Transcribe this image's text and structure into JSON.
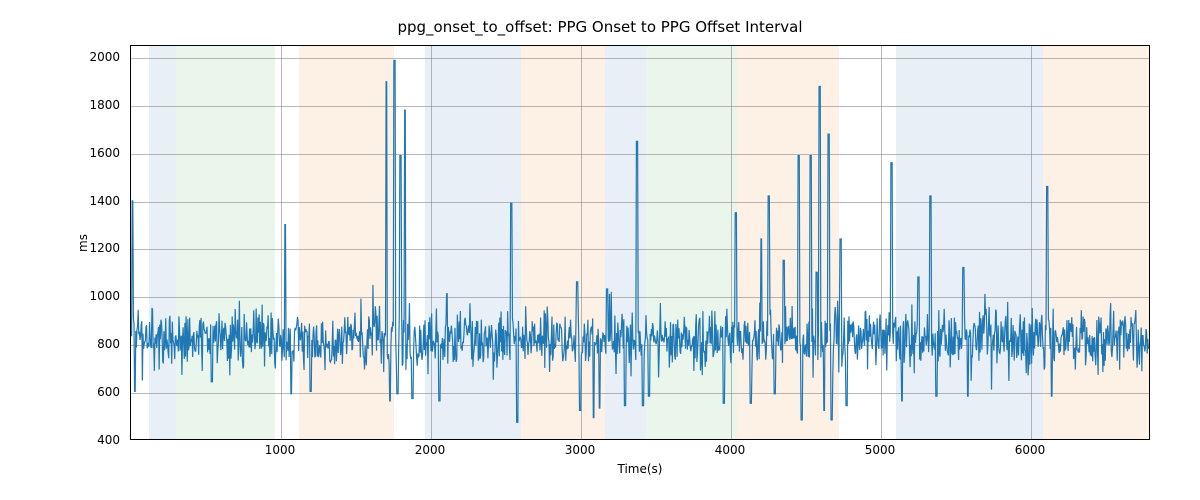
{
  "chart_data": {
    "type": "line",
    "title": "ppg_onset_to_offset: PPG Onset to PPG Offset Interval",
    "xlabel": "Time(s)",
    "ylabel": "ms",
    "xlim": [
      0,
      6800
    ],
    "ylim": [
      400,
      2050
    ],
    "xticks": [
      1000,
      2000,
      3000,
      4000,
      5000,
      6000
    ],
    "yticks": [
      400,
      600,
      800,
      1000,
      1200,
      1400,
      1600,
      1800,
      2000
    ],
    "line_color": "#1f77b4",
    "band_colors": {
      "blue": "#b9cee4",
      "green": "#bfe1c3",
      "orange": "#f9d5b0"
    },
    "bands": [
      {
        "start": 120,
        "end": 300,
        "color": "blue"
      },
      {
        "start": 300,
        "end": 960,
        "color": "green"
      },
      {
        "start": 1120,
        "end": 1750,
        "color": "orange"
      },
      {
        "start": 1960,
        "end": 2600,
        "color": "blue"
      },
      {
        "start": 2600,
        "end": 3160,
        "color": "orange"
      },
      {
        "start": 3160,
        "end": 3430,
        "color": "blue"
      },
      {
        "start": 3430,
        "end": 4040,
        "color": "green"
      },
      {
        "start": 4040,
        "end": 4720,
        "color": "orange"
      },
      {
        "start": 5100,
        "end": 6080,
        "color": "blue"
      },
      {
        "start": 6080,
        "end": 6800,
        "color": "orange"
      }
    ],
    "series": [
      {
        "name": "ppg_onset_to_offset",
        "baseline_mean": 820,
        "baseline_noise_sd": 65,
        "spikes": [
          {
            "t": 10,
            "v": 1400
          },
          {
            "t": 25,
            "v": 600
          },
          {
            "t": 540,
            "v": 640
          },
          {
            "t": 1030,
            "v": 1300
          },
          {
            "t": 1070,
            "v": 590
          },
          {
            "t": 1200,
            "v": 600
          },
          {
            "t": 1705,
            "v": 1900
          },
          {
            "t": 1730,
            "v": 560
          },
          {
            "t": 1760,
            "v": 1990
          },
          {
            "t": 1780,
            "v": 590
          },
          {
            "t": 1800,
            "v": 1590
          },
          {
            "t": 1830,
            "v": 1780
          },
          {
            "t": 1880,
            "v": 570
          },
          {
            "t": 2060,
            "v": 560
          },
          {
            "t": 2110,
            "v": 1010
          },
          {
            "t": 2540,
            "v": 1390
          },
          {
            "t": 2580,
            "v": 470
          },
          {
            "t": 2980,
            "v": 1060
          },
          {
            "t": 3000,
            "v": 520
          },
          {
            "t": 3090,
            "v": 490
          },
          {
            "t": 3130,
            "v": 530
          },
          {
            "t": 3180,
            "v": 1030
          },
          {
            "t": 3300,
            "v": 540
          },
          {
            "t": 3380,
            "v": 1650
          },
          {
            "t": 3420,
            "v": 540
          },
          {
            "t": 3460,
            "v": 580
          },
          {
            "t": 3960,
            "v": 550
          },
          {
            "t": 4040,
            "v": 1350
          },
          {
            "t": 4140,
            "v": 550
          },
          {
            "t": 4210,
            "v": 1240
          },
          {
            "t": 4260,
            "v": 1420
          },
          {
            "t": 4300,
            "v": 590
          },
          {
            "t": 4360,
            "v": 1150
          },
          {
            "t": 4460,
            "v": 1590
          },
          {
            "t": 4480,
            "v": 480
          },
          {
            "t": 4540,
            "v": 1590
          },
          {
            "t": 4580,
            "v": 1100
          },
          {
            "t": 4600,
            "v": 1880
          },
          {
            "t": 4630,
            "v": 520
          },
          {
            "t": 4660,
            "v": 1680
          },
          {
            "t": 4680,
            "v": 480
          },
          {
            "t": 4740,
            "v": 1240
          },
          {
            "t": 4780,
            "v": 540
          },
          {
            "t": 5080,
            "v": 1560
          },
          {
            "t": 5150,
            "v": 560
          },
          {
            "t": 5260,
            "v": 1080
          },
          {
            "t": 5340,
            "v": 1420
          },
          {
            "t": 5380,
            "v": 580
          },
          {
            "t": 5560,
            "v": 1120
          },
          {
            "t": 5590,
            "v": 580
          },
          {
            "t": 6120,
            "v": 1460
          },
          {
            "t": 6150,
            "v": 580
          }
        ]
      }
    ]
  }
}
